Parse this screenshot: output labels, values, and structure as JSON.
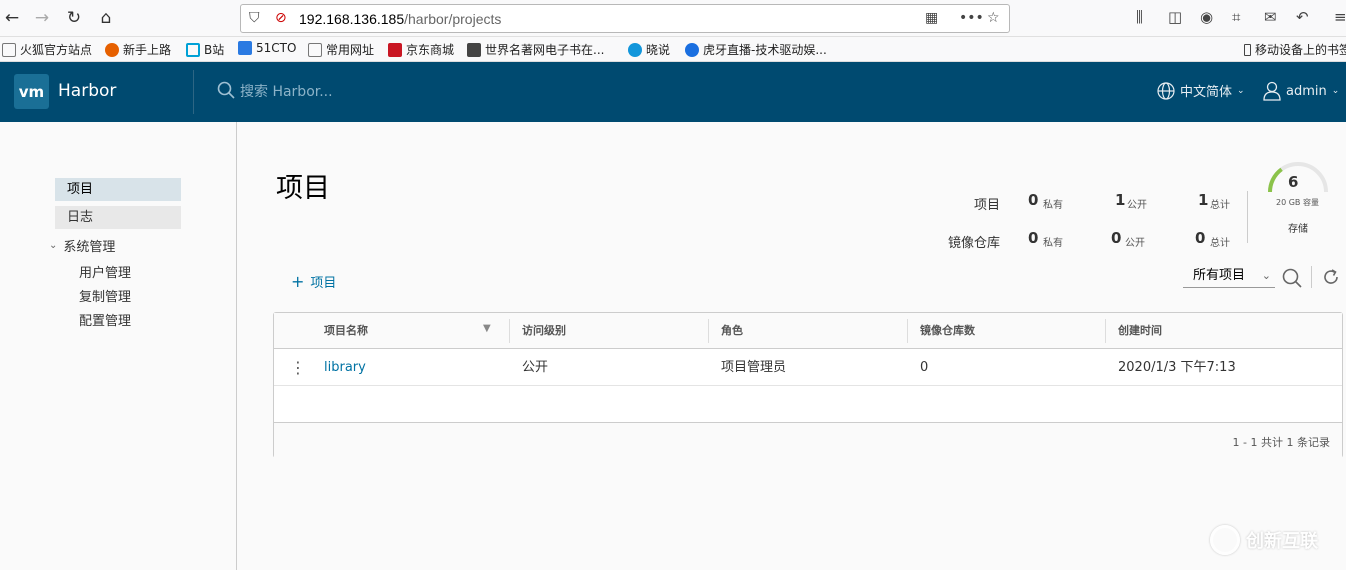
{
  "browser": {
    "url_host": "192.168.136.185",
    "url_path": "/harbor/projects",
    "bookmarks": [
      {
        "label": "火狐官方站点",
        "color": "#777"
      },
      {
        "label": "新手上路",
        "color": "#e66000"
      },
      {
        "label": "B站",
        "color": "#00a1d6"
      },
      {
        "label": "51CTO",
        "color": "#2a7ae2"
      },
      {
        "label": "常用网址",
        "color": "#777"
      },
      {
        "label": "京东商城",
        "color": "#c91623"
      },
      {
        "label": "世界名著网电子书在...",
        "color": "#444"
      },
      {
        "label": "晓说",
        "color": "#1296db"
      },
      {
        "label": "虎牙直播-技术驱动娱...",
        "color": "#1a6fe0"
      }
    ],
    "mobile_bookmarks": "移动设备上的书签"
  },
  "header": {
    "logo": "vm",
    "brand": "Harbor",
    "search_placeholder": "搜索 Harbor...",
    "language": "中文简体",
    "user": "admin"
  },
  "sidebar": {
    "items": [
      {
        "label": "项目"
      },
      {
        "label": "日志"
      }
    ],
    "group": "系统管理",
    "sub_items": [
      {
        "label": "用户管理"
      },
      {
        "label": "复制管理"
      },
      {
        "label": "配置管理"
      }
    ]
  },
  "main": {
    "title": "项目",
    "stats": {
      "projects_label": "项目",
      "repos_label": "镜像仓库",
      "private_unit": "私有",
      "public_unit": "公开",
      "total_unit": "总计",
      "projects": {
        "private": "0",
        "public": "1",
        "total": "1"
      },
      "repos": {
        "private": "0",
        "public": "0",
        "total": "0"
      }
    },
    "storage": {
      "value": "6",
      "capacity": "20 GB 容量",
      "label": "存储",
      "used_fraction": 0.3
    },
    "add_project": "项目",
    "filter": "所有项目",
    "table": {
      "columns": [
        "项目名称",
        "访问级别",
        "角色",
        "镜像仓库数",
        "创建时间"
      ],
      "rows": [
        {
          "name": "library",
          "access": "公开",
          "role": "项目管理员",
          "repos": "0",
          "created": "2020/1/3 下午7:13"
        }
      ],
      "pagination": "1 - 1 共计 1 条记录"
    }
  },
  "watermark": "创新互联",
  "colors": {
    "header_bg": "#004a70",
    "link": "#0072a3",
    "active_nav": "#d8e3e9",
    "gauge_fill": "#8bc34a"
  }
}
